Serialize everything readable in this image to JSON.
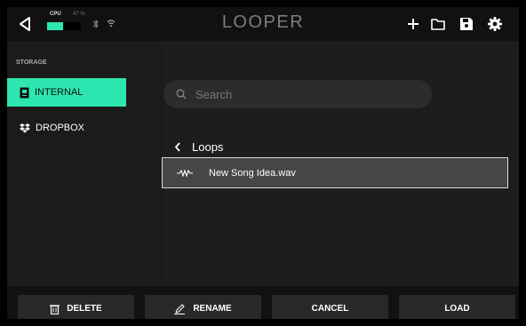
{
  "header": {
    "title": "LOOPER",
    "cpu_label": "CPU",
    "cpu_percent_text": "47 %",
    "cpu_level": 0.47,
    "icons": [
      "back-icon",
      "bluetooth-icon",
      "wifi-icon",
      "add-icon",
      "folder-icon",
      "save-icon",
      "settings-icon"
    ]
  },
  "sidebar": {
    "section_label": "STORAGE",
    "items": [
      {
        "label": "INTERNAL",
        "icon": "device-icon",
        "active": true
      },
      {
        "label": "DROPBOX",
        "icon": "dropbox-icon",
        "active": false
      }
    ]
  },
  "browser": {
    "search_placeholder": "Search",
    "breadcrumb": "Loops",
    "files": [
      {
        "name": "New Song Idea.wav",
        "icon": "audio-wave-icon",
        "selected": true
      }
    ]
  },
  "actions": {
    "delete": "DELETE",
    "rename": "RENAME",
    "cancel": "CANCEL",
    "load": "LOAD"
  },
  "colors": {
    "accent": "#2ee6b0",
    "background": "#1a1a1a",
    "bar": "#111111"
  }
}
